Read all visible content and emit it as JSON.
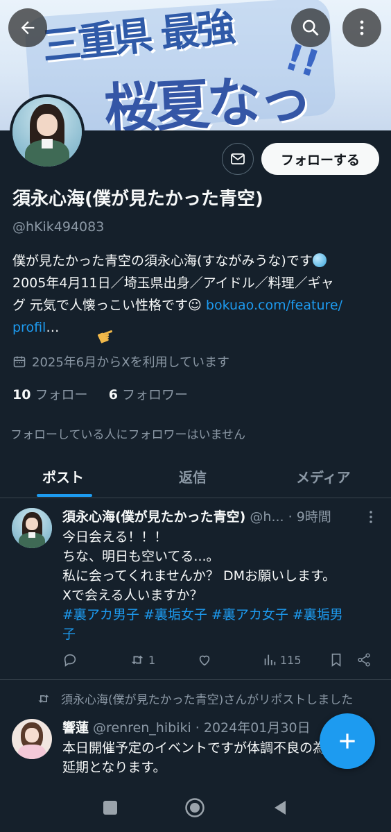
{
  "banner": {
    "line1": "三重県 最強",
    "line2": "桜夏なっ",
    "excl": "!!"
  },
  "profile": {
    "display_name": "須永心海(僕が見たかった青空)",
    "handle": "@hKik494083",
    "bio_lines": [
      "僕が見たかった青空の須永心海(すながみうな)です",
      "2005年4月11日／埼玉県出身／アイドル／料理／ギャ",
      "グ 元気で人懐っこい性格です☺ ",
      "…"
    ],
    "bio_link_1": "bokuao.com/feature/",
    "bio_link_2": "profil",
    "joined": "2025年6月からXを利用しています",
    "following_count": "10",
    "following_label": " フォロー",
    "followers_count": "6",
    "followers_label": " フォロワー",
    "no_mutual_followers": "フォローしている人にフォロワーはいません",
    "follow_button": "フォローする"
  },
  "tabs": [
    "ポスト",
    "返信",
    "メディア"
  ],
  "post": {
    "name": "須永心海(僕が見たかった青空)",
    "handle_time": " @h... · 9時間",
    "lines": [
      "今日会える！！！",
      "ちな、明日も空いてる...。",
      "私に会ってくれませんか？ DMお願いします。",
      "Xで会える人いますか？"
    ],
    "hashtags_line1": "#裏アカ男子 #裏垢女子 #裏アカ女子 #裏垢男",
    "hashtags_line2": "子",
    "repost_count": "1",
    "view_count": "115"
  },
  "repost_note": "須永心海(僕が見たかった青空)さんがリポストしました",
  "post2": {
    "name": "響蓮",
    "handle_date": " @renren_hibiki · 2024年01月30日",
    "lines": [
      "本日開催予定のイベントですが体調不良の為",
      "延期となります。"
    ]
  },
  "colors": {
    "background": "#15202b",
    "accent": "#1d9bf0",
    "muted": "#8b98a5",
    "divider": "#38444d"
  },
  "icons": [
    "back-arrow-icon",
    "search-icon",
    "more-vertical-icon",
    "mail-icon",
    "calendar-icon",
    "reply-icon",
    "repost-icon",
    "like-icon",
    "views-icon",
    "bookmark-icon",
    "share-icon",
    "plus-icon"
  ]
}
